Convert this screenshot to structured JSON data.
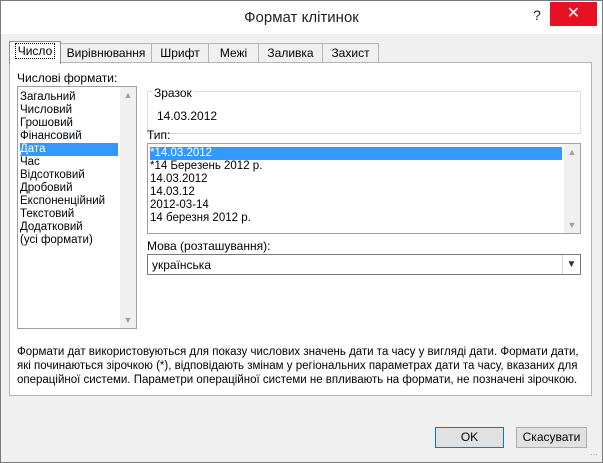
{
  "window": {
    "title": "Формат клітинок",
    "help_label": "?",
    "close_label": "✕"
  },
  "tabs": [
    {
      "label": "Число",
      "active": true
    },
    {
      "label": "Вирівнювання",
      "active": false
    },
    {
      "label": "Шрифт",
      "active": false
    },
    {
      "label": "Межі",
      "active": false
    },
    {
      "label": "Заливка",
      "active": false
    },
    {
      "label": "Захист",
      "active": false
    }
  ],
  "categories": {
    "label": "Числові формати:",
    "items": [
      "Загальний",
      "Числовий",
      "Грошовий",
      "Фінансовий",
      "Дата",
      "Час",
      "Відсотковий",
      "Дробовий",
      "Експоненційний",
      "Текстовий",
      "Додатковий",
      "(усі формати)"
    ],
    "selected": "Дата"
  },
  "sample": {
    "label": "Зразок",
    "value": "14.03.2012"
  },
  "type": {
    "label": "Тип:",
    "items": [
      "*14.03.2012",
      "*14 Березень 2012 р.",
      "14.03.2012",
      "14.03.12",
      "2012-03-14",
      "14 березня 2012 р."
    ],
    "selected": "*14.03.2012"
  },
  "locale": {
    "label": "Мова (розташування):",
    "value": "українська"
  },
  "description": "Формати дат використовуються для показу числових значень дати та часу у вигляді дати. Формати дати, які починаються зірочкою (*), відповідають змінам у регіональних параметрах дати та часу, вказаних для операційної системи.  Параметри операційної системи не впливають на формати, не позначені зірочкою.",
  "buttons": {
    "ok": "OK",
    "cancel": "Скасувати"
  },
  "icons": {
    "scroll_up": "chevron-up-icon",
    "scroll_down": "chevron-down-icon",
    "dropdown": "chevron-down-icon",
    "close": "close-icon",
    "help": "help-icon"
  },
  "colors": {
    "selection": "#3399ff",
    "close_button": "#e81123",
    "ok_border": "#0078d7"
  }
}
